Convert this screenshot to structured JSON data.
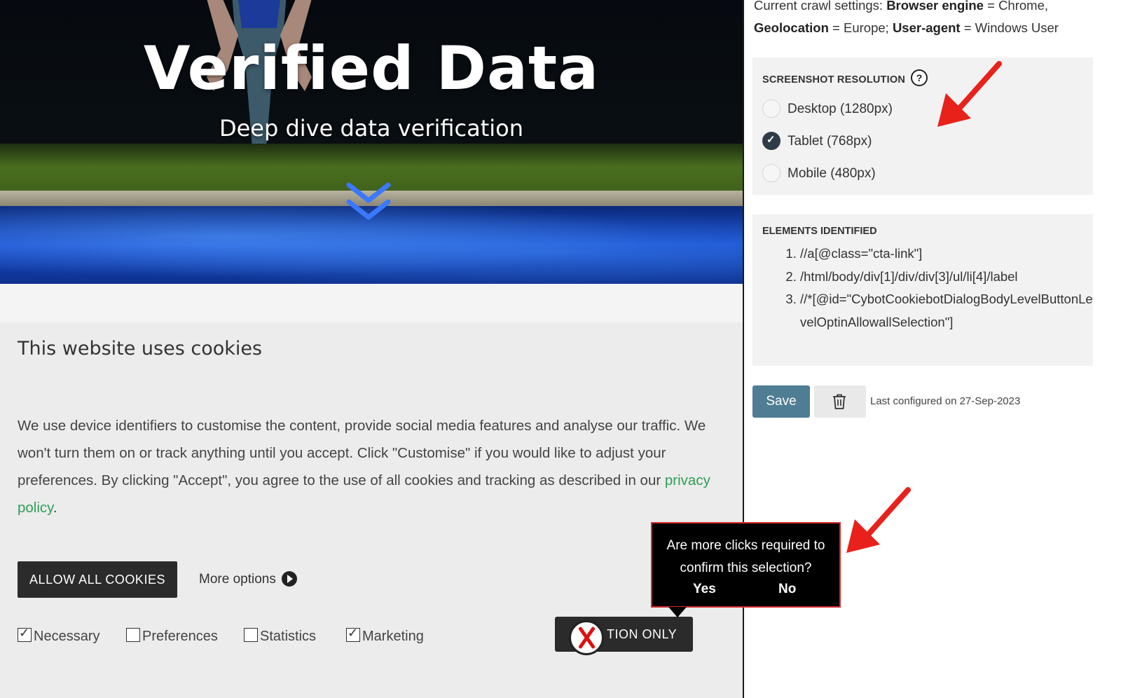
{
  "hero": {
    "title": "Verified Data",
    "subtitle": "Deep dive data verification"
  },
  "cookie_banner": {
    "title": "This website uses cookies",
    "body_text": "We use device identifiers to customise the content, provide social media features and analyse our traffic. We won't turn them on or track anything until you accept. Click \"Customise\" if you would like to adjust your preferences. By clicking \"Accept\", you agree to the use of all cookies and tracking as described in our",
    "privacy_link": "privacy policy",
    "body_end": ".",
    "allow_all_label": "ALLOW ALL COOKIES",
    "more_options_label": "More options",
    "checkboxes": [
      {
        "label": "Necessary",
        "checked": true
      },
      {
        "label": "Preferences",
        "checked": false
      },
      {
        "label": "Statistics",
        "checked": false
      },
      {
        "label": "Marketing",
        "checked": true
      }
    ],
    "selection_button_visible": "TION ONLY"
  },
  "tooltip": {
    "question": "Are more clicks required to confirm this selection?",
    "yes": "Yes",
    "no": "No"
  },
  "settings": {
    "crawl_prefix": "Current crawl settings:",
    "browser_engine_key": "Browser engine",
    "browser_engine_val": "= Chrome,",
    "geolocation_key": "Geolocation",
    "geolocation_val": "= Europe;",
    "user_agent_key": "User-agent",
    "user_agent_val": "= Windows User",
    "resolution_heading": "SCREENSHOT RESOLUTION",
    "help_icon": "?",
    "resolutions": [
      {
        "label": "Desktop (1280px)",
        "selected": false
      },
      {
        "label": "Tablet (768px)",
        "selected": true
      },
      {
        "label": "Mobile (480px)",
        "selected": false
      }
    ],
    "elements_heading": "ELEMENTS IDENTIFIED",
    "elements": [
      "//a[@class=\"cta-link\"]",
      "/html/body/div[1]/div/div[3]/ul/li[4]/label",
      "//*[@id=\"CybotCookiebotDialogBodyLevelButtonLevelOptinAllowallSelection\"]"
    ],
    "save_label": "Save",
    "last_configured": "Last configured on 27-Sep-2023"
  },
  "colors": {
    "annotation_red": "#e8221b",
    "save_button": "#4f7d93",
    "link_green": "#2f9e55"
  }
}
